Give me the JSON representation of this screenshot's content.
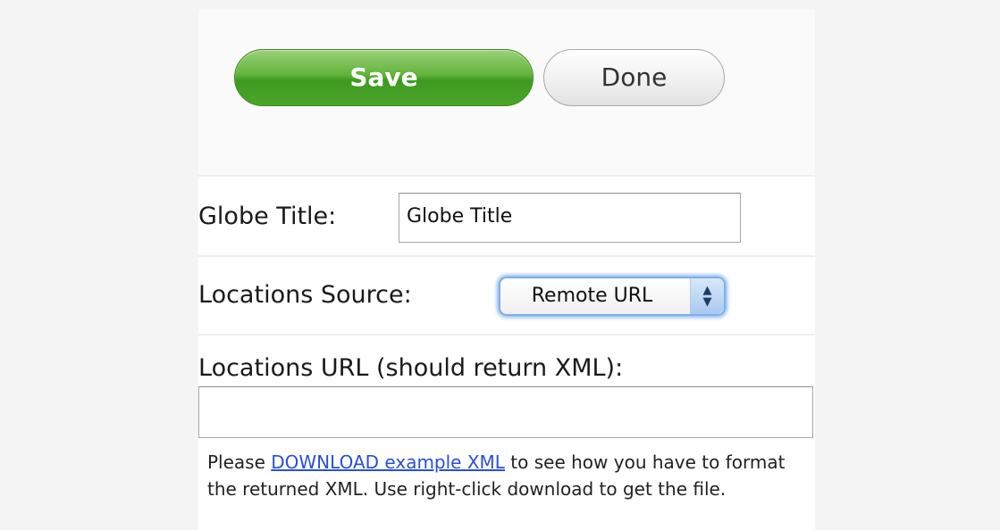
{
  "toolbar": {
    "save_label": "Save",
    "done_label": "Done"
  },
  "form": {
    "globe_title": {
      "label": "Globe Title:",
      "value": "Globe Title"
    },
    "locations_source": {
      "label": "Locations Source:",
      "selected": "Remote URL"
    },
    "locations_url": {
      "label": "Locations URL (should return XML):",
      "value": ""
    }
  },
  "help": {
    "prefix": "Please ",
    "link_text": "DOWNLOAD example XML",
    "suffix": " to see how you have to format the returned XML. Use right-click download to get the file."
  },
  "colors": {
    "save_button": "#4aa52a",
    "focus_ring": "#8ab8ee",
    "link": "#2a4fd8"
  }
}
